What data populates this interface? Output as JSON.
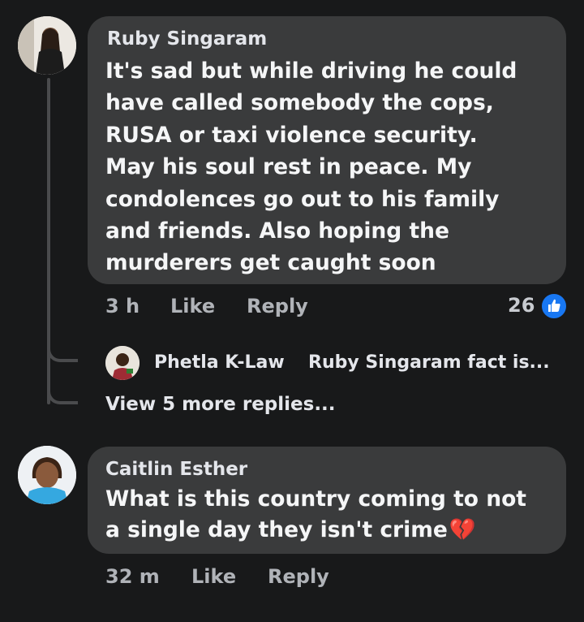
{
  "comments": [
    {
      "author": "Ruby Singaram",
      "text_lines": [
        "It's sad but while driving he could",
        "have called somebody the cops,",
        "RUSA or taxi violence security.",
        "May his soul rest in peace. My",
        "condolences go out to his family",
        "and friends. Also hoping the",
        "murderers get caught soon"
      ],
      "time": "3 h",
      "like_label": "Like",
      "reply_label": "Reply",
      "reaction_count": "26",
      "reaction_icon": "thumbs-up-icon",
      "reply_preview": {
        "author": "Phetla K-Law",
        "snippet": "Ruby Singaram fact is..."
      },
      "view_more": "View 5 more replies..."
    },
    {
      "author": "Caitlin Esther",
      "text_lines": [
        "What is this country coming to not",
        "a single day they isn't crime"
      ],
      "emoji": "💔",
      "time": "32 m",
      "like_label": "Like",
      "reply_label": "Reply"
    }
  ],
  "colors": {
    "background": "#18191a",
    "bubble": "#3a3b3c",
    "meta_text": "#b0b3b8",
    "like_badge": "#1877f2"
  }
}
